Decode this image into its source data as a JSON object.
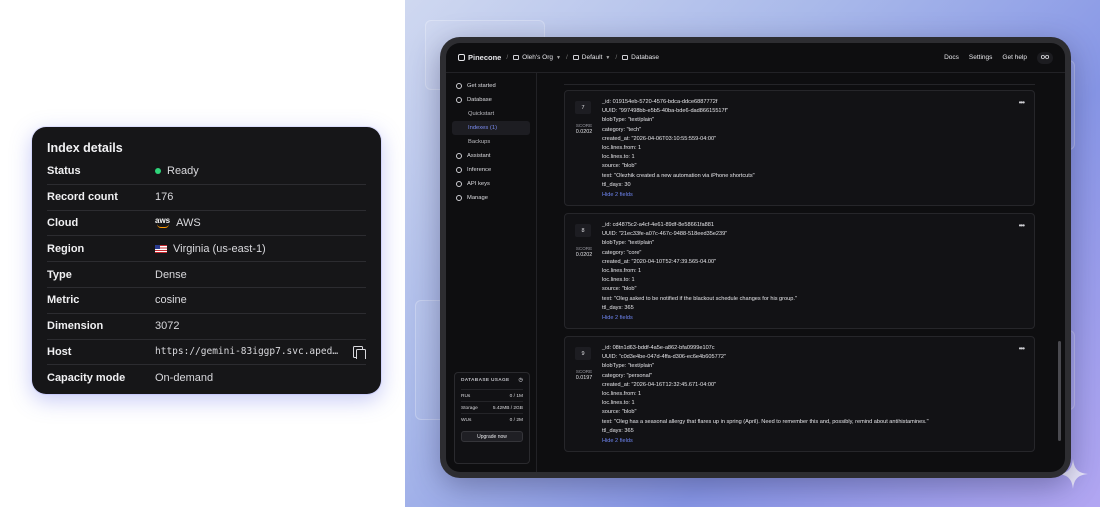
{
  "index_details": {
    "title": "Index details",
    "rows": [
      {
        "key": "Status",
        "value": "Ready"
      },
      {
        "key": "Record count",
        "value": "176"
      },
      {
        "key": "Cloud",
        "value": "AWS"
      },
      {
        "key": "Region",
        "value": "Virginia (us-east-1)"
      },
      {
        "key": "Type",
        "value": "Dense"
      },
      {
        "key": "Metric",
        "value": "cosine"
      },
      {
        "key": "Dimension",
        "value": "3072"
      },
      {
        "key": "Host",
        "value": "https://gemini-83iggp7.svc.aped-4627…"
      },
      {
        "key": "Capacity mode",
        "value": "On-demand"
      }
    ],
    "status_color": "#2fd47a"
  },
  "topbar": {
    "brand": "Pinecone",
    "org": "Oleh's Org",
    "project": "Default",
    "page": "Database",
    "links": [
      "Docs",
      "Settings",
      "Get help"
    ],
    "avatar": "OO"
  },
  "sidebar": {
    "items": [
      {
        "label": "Get started",
        "icon": "rocket-icon"
      },
      {
        "label": "Database",
        "icon": "database-icon"
      },
      {
        "label": "Quickstart",
        "icon": ""
      },
      {
        "label": "Indexes (1)",
        "icon": ""
      },
      {
        "label": "Backups",
        "icon": ""
      },
      {
        "label": "Assistant",
        "icon": "assistant-icon"
      },
      {
        "label": "Inference",
        "icon": "inference-icon"
      },
      {
        "label": "API keys",
        "icon": "key-icon"
      },
      {
        "label": "Manage",
        "icon": "gear-icon"
      }
    ],
    "usage": {
      "title": "DATABASE USAGE",
      "rows": [
        {
          "label": "RUs",
          "value": "0 / 1M"
        },
        {
          "label": "Storage",
          "value": "5.42MB / 2GB"
        },
        {
          "label": "WUs",
          "value": "0 / 2M"
        }
      ],
      "upgrade_label": "Upgrade now"
    }
  },
  "records": [
    {
      "rank": "7",
      "score_label": "SCORE",
      "score": "0.0202",
      "fields": [
        "_id: 019154eb-5720-4576-bdca-ddce6887772f",
        "UUID: \"997498bb-e5b5-40ba-bde6-dad86615517f\"",
        "blobType: \"text/plain\"",
        "category: \"tech\"",
        "created_at: \"2026-04-06T03:10:55:559-04:00\"",
        "loc.lines.from: 1",
        "loc.lines.to: 1",
        "source: \"blob\"",
        "text: \"Olezhik created a new automation via iPhone shortcuts\"",
        "ttl_days: 30"
      ],
      "hide_label": "Hide 2 fields"
    },
    {
      "rank": "8",
      "score_label": "SCORE",
      "score": "0.0202",
      "fields": [
        "_id: cd4875c2-a4cf-4e61-89df-8e58661fa881",
        "UUID: \"21ec33fe-a07c-467c-9488-518eed35e239\"",
        "blobType: \"text/plain\"",
        "category: \"core\"",
        "created_at: \"2020-04-10T52:47:39.565-04.00\"",
        "loc.lines.from: 1",
        "loc.lines.to: 1",
        "source: \"blob\"",
        "text: \"Oleg asked to be notified if the blackout schedule changes for his group.\"",
        "ttl_days: 365"
      ],
      "hide_label": "Hide 2 fields"
    },
    {
      "rank": "9",
      "score_label": "SCORE",
      "score": "0.0197",
      "fields": [
        "_id: 08tn1d63-bddf-4a5e-a862-bfa0999e107c",
        "UUID: \"c0d3e4be-047d-4ffa-d306-ec6e4b605772\"",
        "blobType: \"text/plain\"",
        "category: \"personal\"",
        "created_at: \"2026-04-16T12:32:45.671-04:00\"",
        "loc.lines.from: 1",
        "loc.lines.to: 1",
        "source: \"blob\"",
        "text: \"Oleg has a seasonal allergy that flares up in spring (April). Need to remember this and, possibly, remind about antihistamines.\"",
        "ttl_days: 365"
      ],
      "hide_label": "Hide 2 fields"
    }
  ]
}
